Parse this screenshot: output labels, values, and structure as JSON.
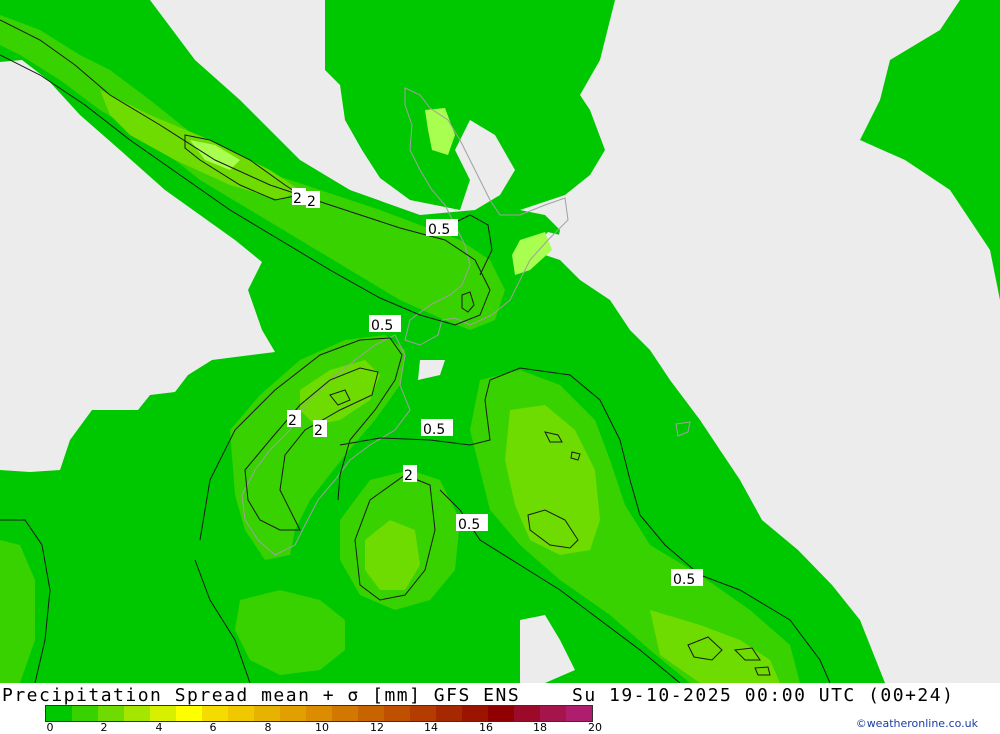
{
  "map": {
    "colors": {
      "dry": "#ececec",
      "light": "#00c800",
      "medium": "#37d200",
      "heavy": "#6edc00",
      "heaviest": "#a8ff50",
      "contour": "#1a1a1a",
      "coast": "#a0a0a0"
    },
    "contour_labels": [
      "2",
      "2",
      "0.5",
      "0.5",
      "2",
      "2",
      "0.5",
      "2",
      "0.5",
      "0.5"
    ]
  },
  "footer": {
    "title": "Precipitation Spread mean + σ [mm] GFS ENS",
    "datetime": "Su 19-10-2025 00:00 UTC (00+24)",
    "credit": "©weatheronline.co.uk",
    "scale_colors": [
      "#00c800",
      "#37d200",
      "#6edc00",
      "#a5e600",
      "#d7f000",
      "#ffff00",
      "#f5dc00",
      "#f0c800",
      "#e6b400",
      "#e1a000",
      "#dc8c00",
      "#d27800",
      "#c86400",
      "#be5000",
      "#b43c00",
      "#a52800",
      "#9b1400",
      "#910000",
      "#9b0a28",
      "#a5144b",
      "#af1e6e"
    ],
    "scale_ticks": [
      "0",
      "2",
      "4",
      "6",
      "8",
      "10",
      "12",
      "14",
      "16",
      "18",
      "20"
    ]
  }
}
